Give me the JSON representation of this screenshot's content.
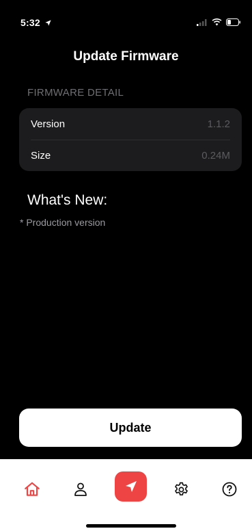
{
  "status_bar": {
    "time": "5:32"
  },
  "header": {
    "title": "Update Firmware"
  },
  "firmware_detail": {
    "section_label": "FIRMWARE DETAIL",
    "rows": [
      {
        "key": "Version",
        "value": "1.1.2"
      },
      {
        "key": "Size",
        "value": "0.24M"
      }
    ]
  },
  "whats_new": {
    "heading": "What's New:",
    "note": "* Production version"
  },
  "actions": {
    "update_label": "Update"
  },
  "tab_bar": {
    "items": [
      {
        "icon": "home-icon",
        "active": true
      },
      {
        "icon": "profile-icon",
        "active": false
      },
      {
        "icon": "navigation-icon",
        "active": false
      },
      {
        "icon": "gear-icon",
        "active": false
      },
      {
        "icon": "help-icon",
        "active": false
      }
    ],
    "accent_color": "#ef4444"
  }
}
